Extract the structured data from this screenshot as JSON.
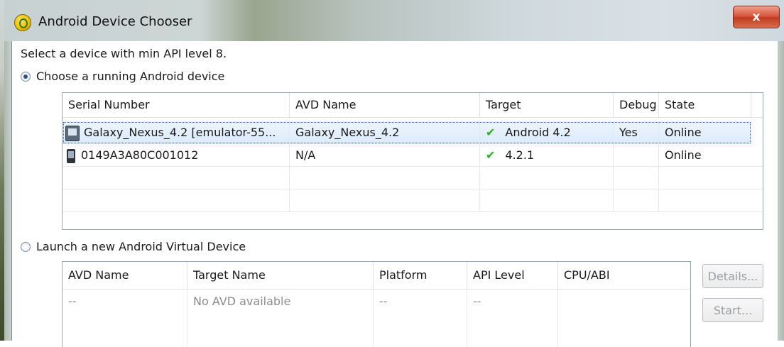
{
  "window": {
    "title": "Android Device Chooser",
    "close_label": "x"
  },
  "prompt": "Select a device with min API level 8.",
  "running": {
    "radio_label": "Choose a running Android device",
    "selected": true,
    "columns": [
      "Serial Number",
      "AVD Name",
      "Target",
      "Debug",
      "State"
    ],
    "rows": [
      {
        "serial": "Galaxy_Nexus_4.2 [emulator-55...",
        "avd": "Galaxy_Nexus_4.2",
        "target": "Android 4.2",
        "debug": "Yes",
        "state": "Online",
        "icon": "emulator-icon"
      },
      {
        "serial": "0149A3A80C001012",
        "avd": "N/A",
        "target": "4.2.1",
        "debug": "",
        "state": "Online",
        "icon": "phone-icon"
      }
    ]
  },
  "launch": {
    "radio_label": "Launch a new Android Virtual Device",
    "selected": false,
    "columns": [
      "AVD Name",
      "Target Name",
      "Platform",
      "API Level",
      "CPU/ABI"
    ],
    "rows": [
      {
        "avd": "--",
        "target": "No AVD available",
        "platform": "--",
        "api": "--",
        "cpu": ""
      }
    ],
    "buttons": {
      "details": "Details...",
      "start": "Start..."
    }
  },
  "icons": {
    "check": "check-icon",
    "target_check_color": "#22b522"
  }
}
